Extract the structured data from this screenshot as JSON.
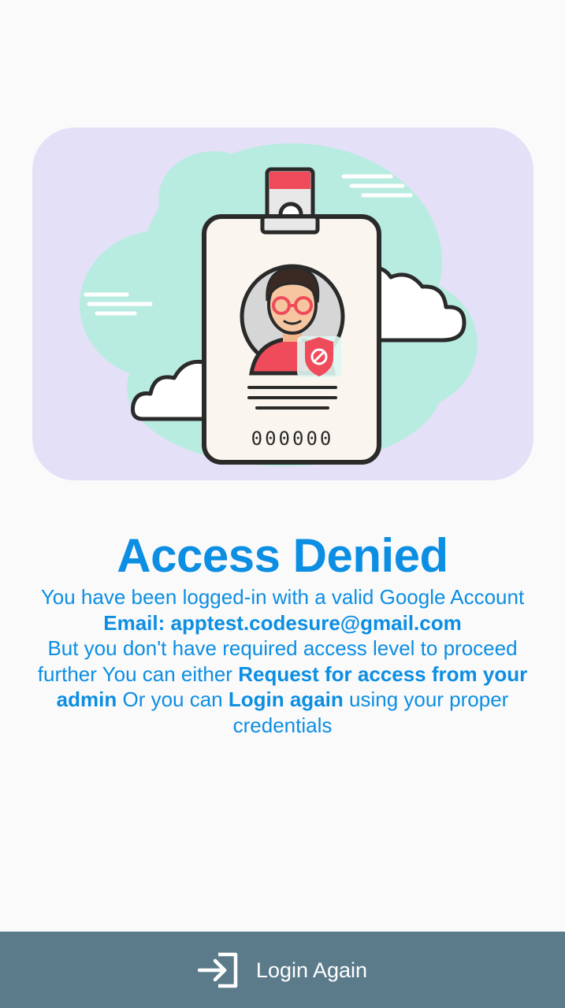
{
  "illustration": {
    "icon": "id-card-access-denied-illustration",
    "badge_number": "000000"
  },
  "message": {
    "title": "Access Denied",
    "line1": "You have been logged-in with a valid Google Account",
    "email_label": "Email: apptest.codesure@gmail.com",
    "line3_pre": "But you don't have required access level to proceed further You can either",
    "request_link": "Request for access from your admin",
    "line3_mid": "Or you can",
    "login_link": "Login again",
    "line3_post": "using your proper credentials"
  },
  "bottom_bar": {
    "icon": "login-icon",
    "label": "Login Again"
  },
  "colors": {
    "accent": "#0c8ee3",
    "bottom_bar": "#5b7b8b",
    "background": "#fafafa",
    "illustration_bg": "#e4e0f7",
    "cloud": "#b9ece0"
  }
}
